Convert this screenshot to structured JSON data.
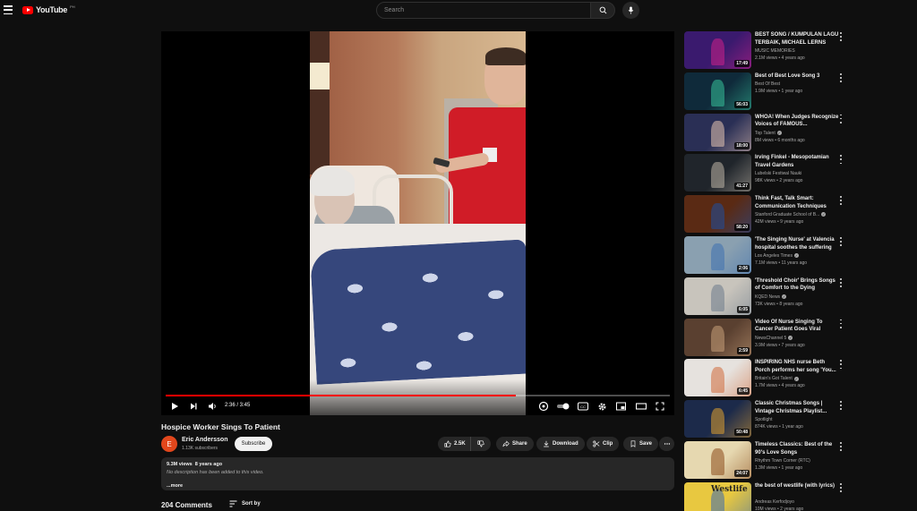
{
  "header": {
    "logo_text": "YouTube",
    "logo_sup": "PH",
    "search_placeholder": "Search"
  },
  "player": {
    "time_display": "2:36 / 3:45",
    "progress_played": 0.695,
    "progress_buffered": 0.69
  },
  "video": {
    "title": "Hospice Worker Sings To Patient",
    "channel_name": "Eric Andersson",
    "channel_initial": "E",
    "subscribers": "1.13K subscribers",
    "subscribe_label": "Subscribe",
    "like_count": "2.5K",
    "share_label": "Share",
    "download_label": "Download",
    "clip_label": "Clip",
    "save_label": "Save"
  },
  "description": {
    "meta": "9.3M views  8 years ago",
    "text": "No description has been added to this video.",
    "more_label": "...more"
  },
  "comments": {
    "count_label": "204 Comments",
    "sort_label": "Sort by"
  },
  "recommendations": [
    {
      "title": "BEST SONG / KUMPULAN LAGU TERBAIK, MICHAEL LERNS TO...",
      "channel": "MUSIC MEMORIES",
      "verified": false,
      "views": "2.1M views",
      "age": "4 years ago",
      "duration": "17:49",
      "bg": "#3a1a6e",
      "accent": "#d0208a"
    },
    {
      "title": "Best of Best Love Song 3",
      "channel": "Best Of Best",
      "verified": false,
      "views": "1.9M views",
      "age": "1 year ago",
      "duration": "56:03",
      "bg": "#0f2a3a",
      "accent": "#36c29a"
    },
    {
      "title": "WHOA! When Judges Recognize Voices of FAMOUS...",
      "channel": "Top Talent",
      "verified": true,
      "views": "8M views",
      "age": "6 months ago",
      "duration": "18:00",
      "bg": "#2a2f55",
      "accent": "#e8c6b2"
    },
    {
      "title": "Irving Finkel - Mesopotamian Travel Gardens",
      "channel": "Lubelski Festiwal Nauki",
      "verified": false,
      "views": "98K views",
      "age": "2 years ago",
      "duration": "41:27",
      "bg": "#20252b",
      "accent": "#bfb6a8"
    },
    {
      "title": "Think Fast, Talk Smart: Communication Techniques",
      "channel": "Stanford Graduate School of B...",
      "verified": true,
      "views": "42M views",
      "age": "9 years ago",
      "duration": "58:20",
      "bg": "#5a2a14",
      "accent": "#1e4fa0"
    },
    {
      "title": "'The Singing Nurse' at Valencia hospital soothes the suffering",
      "channel": "Los Angeles Times",
      "verified": true,
      "views": "7.1M views",
      "age": "11 years ago",
      "duration": "2:06",
      "bg": "#8aa0b0",
      "accent": "#3c6fb0"
    },
    {
      "title": "'Threshold Choir' Brings Songs of Comfort to the Dying",
      "channel": "KQED News",
      "verified": true,
      "views": "73K views",
      "age": "8 years ago",
      "duration": "6:05",
      "bg": "#c8c4bc",
      "accent": "#6c7a8a"
    },
    {
      "title": "Video Of Nurse Singing To Cancer Patient Goes Viral",
      "channel": "NewsChannel 5",
      "verified": true,
      "views": "3.9M views",
      "age": "7 years ago",
      "duration": "2:59",
      "bg": "#5a4030",
      "accent": "#c9a07a"
    },
    {
      "title": "INSPIRING NHS nurse Beth Porch performs her song 'You...",
      "channel": "Britain's Got Talent",
      "verified": true,
      "views": "1.7M views",
      "age": "4 years ago",
      "duration": "6:45",
      "bg": "#e6e2de",
      "accent": "#d06a3a"
    },
    {
      "title": "Classic Christmas Songs | Vintage Christmas Playlist...",
      "channel": "Spotlight",
      "verified": false,
      "views": "874K views",
      "age": "1 year ago",
      "duration": "50:48",
      "bg": "#1c2a4a",
      "accent": "#e0a030"
    },
    {
      "title": "Timeless Classics: Best of the 90's Love Songs",
      "channel": "Rhythm Town Corner (RTC)",
      "verified": false,
      "views": "1.3M views",
      "age": "1 year ago",
      "duration": "24:07",
      "bg": "#e6d8b0",
      "accent": "#8a4a1a"
    },
    {
      "title": "the best of westlife (with lyrics)",
      "channel": "Andreas Kerfodjoyo",
      "verified": false,
      "views": "10M views",
      "age": "2 years ago",
      "duration": "",
      "bg": "#e8c840",
      "accent": "#3a6ab0",
      "thumb_text": "Westlife"
    }
  ]
}
